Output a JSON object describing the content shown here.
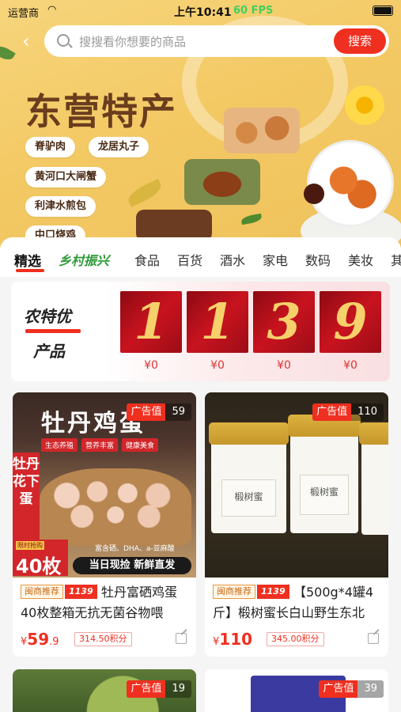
{
  "status_bar": {
    "carrier": "运营商",
    "time": "上午10:41",
    "fps": "60 FPS"
  },
  "search": {
    "placeholder": "搜搜看你想要的商品",
    "button_label": "搜索"
  },
  "hero": {
    "title": "东营特产",
    "tags": [
      "脊驴肉",
      "龙居丸子",
      "黄河口大闸蟹",
      "利津水煎包",
      "中口烧鸡"
    ]
  },
  "tabs": [
    "精选",
    "乡村振兴",
    "食品",
    "百货",
    "酒水",
    "家电",
    "数码",
    "美妆",
    "其"
  ],
  "promo": {
    "title_line1": "农特优",
    "title_line2": "产品",
    "digits": [
      "1",
      "1",
      "3",
      "9"
    ],
    "prices": [
      "¥0",
      "¥0",
      "¥0",
      "¥0"
    ]
  },
  "products": [
    {
      "ad_label": "广告值",
      "ad_count": "59",
      "label_merchant": "闽商推荐",
      "label_code": "1139",
      "name": "牡丹富硒鸡蛋40枚整箱无抗无菌谷物喂",
      "price_symbol": "¥",
      "price_int": "59",
      "price_dec": ".9",
      "points": "314.50积分",
      "image_text": {
        "title": "牡丹鸡蛋",
        "badges": [
          "生态养殖",
          "营养丰富",
          "健康美食"
        ],
        "side": "牡丹花下蛋",
        "sub": "富含硒、DHA、a-亚麻酸",
        "limited": "限时抢购",
        "count": "40枚",
        "ship": "当日现捡 新鲜直发"
      }
    },
    {
      "ad_label": "广告值",
      "ad_count": "110",
      "label_merchant": "闽商推荐",
      "label_code": "1139",
      "name": "【500g*4罐4斤】椴树蜜长白山野生东北",
      "price_symbol": "¥",
      "price_int": "110",
      "price_dec": "",
      "points": "345.00积分",
      "image_text": {
        "jar_label": "椴树蜜"
      }
    },
    {
      "ad_label": "广告值",
      "ad_count": "19"
    },
    {
      "ad_label": "广告值",
      "ad_count": "39"
    }
  ],
  "colors": {
    "accent": "#ef2f1f",
    "brand_green": "#2f9a3a",
    "hero_bg": "#f3c964"
  }
}
